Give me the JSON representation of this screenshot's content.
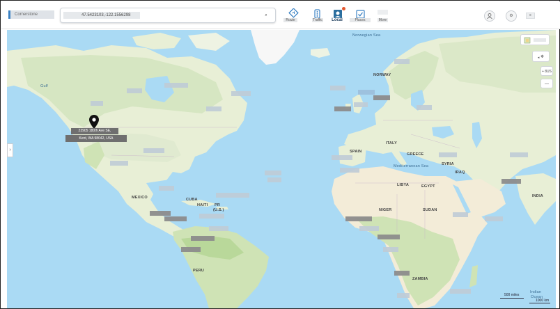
{
  "app": {
    "logo_text": "Cornerstone",
    "search_value": "47.5423103,-122.1556298",
    "search_button_label": "⌕"
  },
  "toolbar": {
    "tools": [
      {
        "name": "directions",
        "label": "Route"
      },
      {
        "name": "traffic",
        "label": "Traffic"
      },
      {
        "name": "local",
        "label": "Local"
      },
      {
        "name": "my-places",
        "label": "Places"
      },
      {
        "name": "more",
        "label": "More"
      }
    ],
    "account_label": "",
    "settings_label": "⚙",
    "menu_label": "≡"
  },
  "map": {
    "pin": {
      "title": "23905 180th Ave SE,",
      "subtitle": "Kent, WA 98042, USA"
    },
    "labels": [
      {
        "text": "Gulf",
        "kind": "sea"
      },
      {
        "text": "Norwegian Sea",
        "kind": "sea"
      },
      {
        "text": "NORWAY",
        "kind": "country"
      },
      {
        "text": "SPAIN",
        "kind": "country"
      },
      {
        "text": "ITALY",
        "kind": "country"
      },
      {
        "text": "GREECE",
        "kind": "country"
      },
      {
        "text": "Mediterranean Sea",
        "kind": "sea"
      },
      {
        "text": "SYRIA",
        "kind": "country"
      },
      {
        "text": "IRAQ",
        "kind": "country"
      },
      {
        "text": "LIBYA",
        "kind": "country"
      },
      {
        "text": "EGYPT",
        "kind": "country"
      },
      {
        "text": "NIGER",
        "kind": "country"
      },
      {
        "text": "SUDAN",
        "kind": "country"
      },
      {
        "text": "INDIA",
        "kind": "country"
      },
      {
        "text": "MEXICO",
        "kind": "country"
      },
      {
        "text": "CUBA",
        "kind": "country"
      },
      {
        "text": "HAITI",
        "kind": "country"
      },
      {
        "text": "PR",
        "kind": "country"
      },
      {
        "text": "(U.S.)",
        "kind": "country"
      },
      {
        "text": "PERU",
        "kind": "country"
      },
      {
        "text": "ZAMBIA",
        "kind": "country"
      },
      {
        "text": "Indian",
        "kind": "sea"
      },
      {
        "text": "Ocean",
        "kind": "sea"
      }
    ],
    "scale_miles": "500 miles",
    "scale_km": "1000 km",
    "controls": {
      "layers_label": "",
      "locate_label": "⌖",
      "zoom_in_label": "+ 8US",
      "zoom_out_label": "—"
    },
    "side_toggle": "›"
  },
  "colors": {
    "water": "#aadaf4",
    "land": "#e8efd6",
    "forest": "#cfe3b5",
    "desert": "#f3ecd8",
    "ice": "#f7f7f7",
    "accent": "#3b82c4",
    "local_badge": "#e4572e"
  }
}
